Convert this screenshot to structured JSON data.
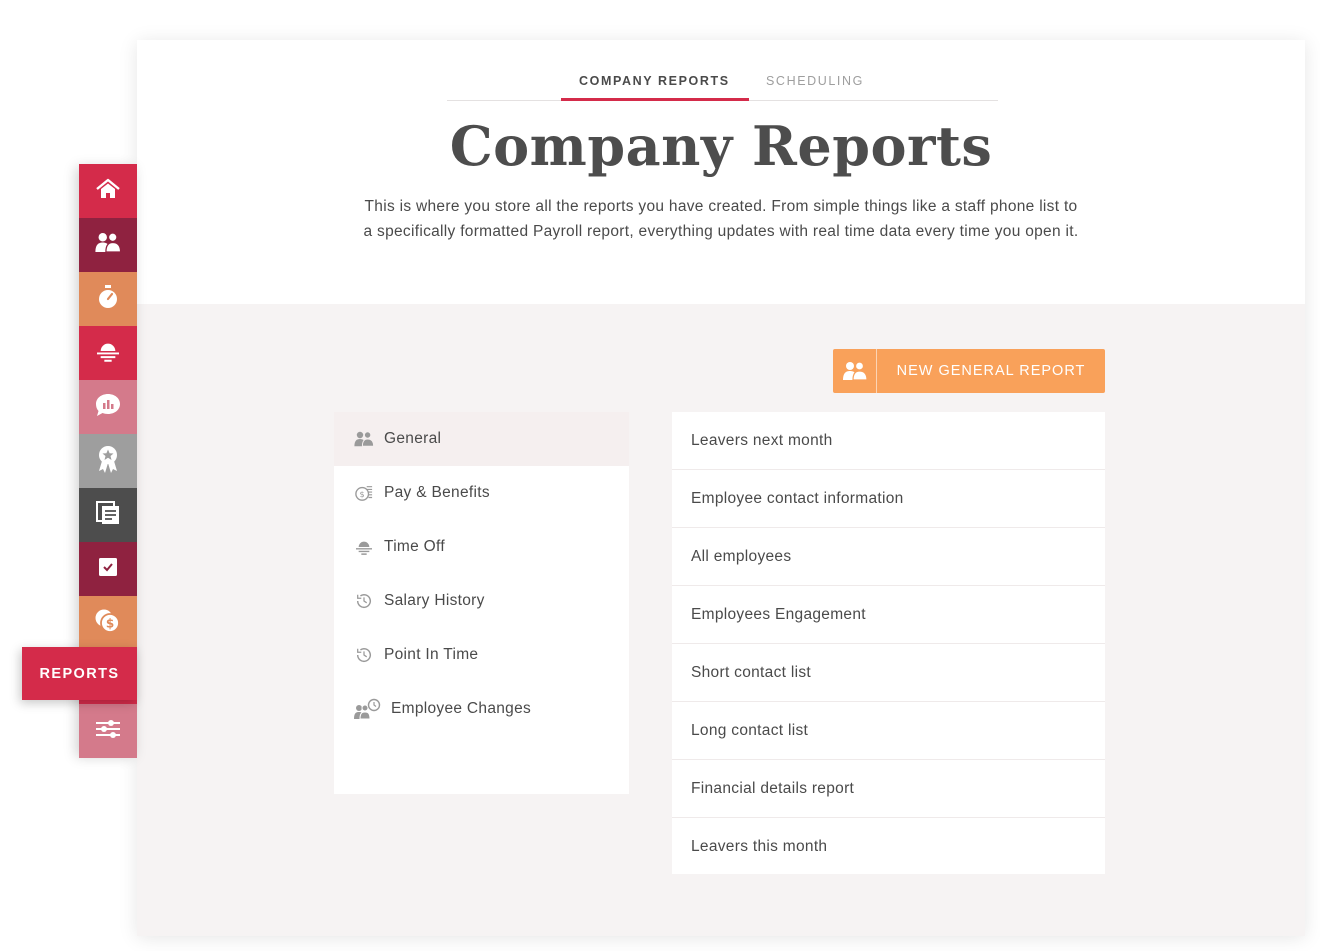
{
  "tabs": [
    {
      "label": "COMPANY REPORTS",
      "active": true
    },
    {
      "label": "SCHEDULING",
      "active": false
    }
  ],
  "page_title": "Company Reports",
  "intro": "This is where you store all the reports you have created. From simple things like a staff phone list to a specifically formatted Payroll report, everything updates with real time data every time you open it.",
  "new_report_button": {
    "label": "NEW GENERAL REPORT",
    "icon": "people-icon"
  },
  "categories": [
    {
      "label": "General",
      "icon": "people-icon",
      "selected": true
    },
    {
      "label": "Pay & Benefits",
      "icon": "money-icon",
      "selected": false
    },
    {
      "label": "Time Off",
      "icon": "sunset-icon",
      "selected": false
    },
    {
      "label": "Salary History",
      "icon": "history-clock-icon",
      "selected": false
    },
    {
      "label": "Point In Time",
      "icon": "history-clock-icon",
      "selected": false
    },
    {
      "label": "Employee Changes",
      "icon": "people-clock-icon",
      "selected": false
    }
  ],
  "reports": [
    "Leavers next month",
    "Employee contact information",
    "All employees",
    "Employees Engagement",
    "Short contact list",
    "Long contact list",
    "Financial details report",
    "Leavers this month"
  ],
  "sidebar": {
    "items": [
      {
        "icon": "home-icon",
        "color": "#d42b4a"
      },
      {
        "icon": "people-icon",
        "color": "#8f2240"
      },
      {
        "icon": "stopwatch-icon",
        "color": "#e08a5a"
      },
      {
        "icon": "sunset-icon",
        "color": "#d42b4a"
      },
      {
        "icon": "chat-chart-icon",
        "color": "#d47a8b"
      },
      {
        "icon": "award-icon",
        "color": "#9e9e9e"
      },
      {
        "icon": "documents-icon",
        "color": "#4d4d4d"
      },
      {
        "icon": "checkbox-icon",
        "color": "#8f2240"
      },
      {
        "icon": "coins-icon",
        "color": "#e08a5a"
      },
      {
        "icon": "reports-icon",
        "color": "#d42b4a"
      },
      {
        "icon": "sliders-icon",
        "color": "#d47a8b"
      }
    ],
    "active_label": "REPORTS"
  },
  "colors": {
    "accent": "#d42b4a",
    "button": "#f9a15a",
    "background": "#f6f3f3"
  }
}
